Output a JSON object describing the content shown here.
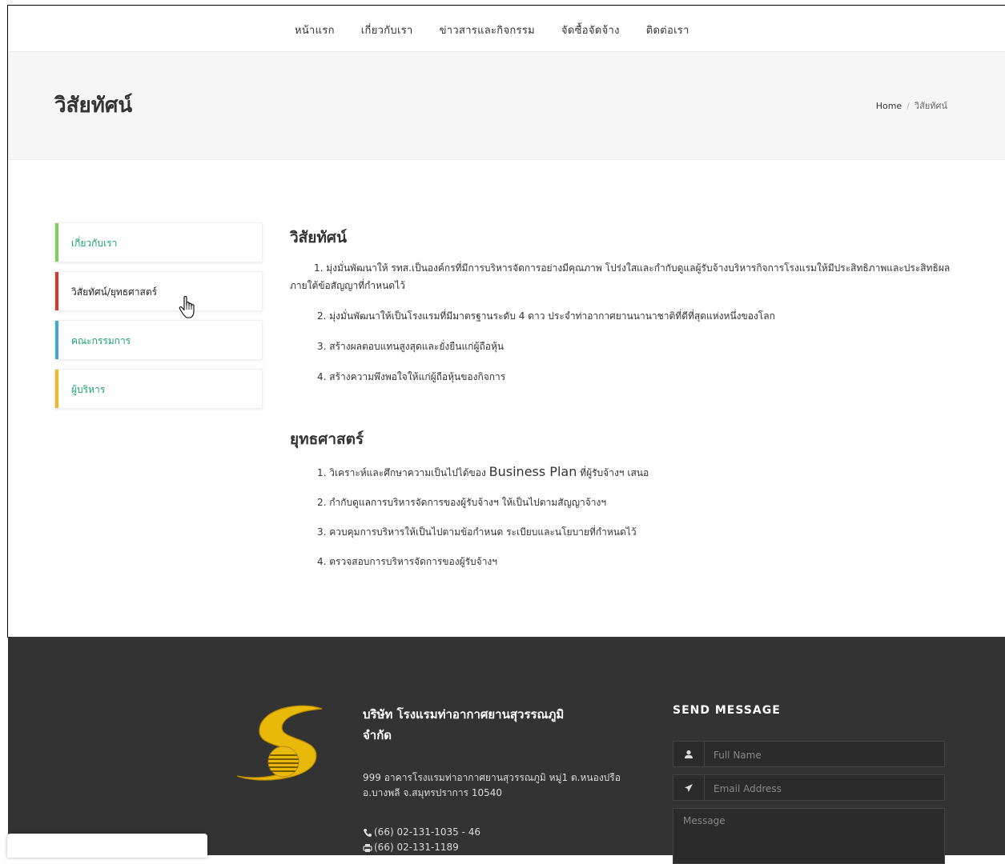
{
  "nav": {
    "items": [
      "หน้าแรก",
      "เกี่ยวกับเรา",
      "ข่าวสารและกิจกรรม",
      "จัดซื้อจัดจ้าง",
      "ติดต่อเรา"
    ]
  },
  "page": {
    "title": "วิสัยทัศน์",
    "breadcrumb": {
      "home": "Home",
      "separator": "/",
      "current": "วิสัยทัศน์"
    }
  },
  "sidebar": {
    "items": [
      {
        "label": "เกี่ยวกับเรา",
        "color": "#7fd05a",
        "active": false
      },
      {
        "label": "วิสัยทัศน์/ยุทธศาสตร์",
        "color": "#d9392b",
        "active": true
      },
      {
        "label": "คณะกรรมการ",
        "color": "#3fa9d6",
        "active": false
      },
      {
        "label": "ผู้บริหาร",
        "color": "#f5b529",
        "active": false
      }
    ]
  },
  "content": {
    "vision_title": "วิสัยทัศน์",
    "vision": [
      "1. มุ่งมั่นพัฒนาให้ รทส.เป็นองค์กรที่มีการบริหารจัดการอย่างมีคุณภาพ โปร่งใสและกำกับดูแลผู้รับจ้างบริหารกิจการโรงแรมให้มีประสิทธิภาพและประสิทธิผลภายใต้ข้อสัญญาที่กำหนดไว้",
      "2. มุ่งมั่นพัฒนาให้เป็นโรงแรมที่มีมาตรฐานระดับ 4 ดาว ประจำท่าอากาศยานนานาชาติที่ดีที่สุดแห่งหนึ่งของโลก",
      "3. สร้างผลตอบแทนสูงสุดและยั่งยืนแก่ผู้ถือหุ้น",
      "4. สร้างความพึงพอใจให้แก่ผู้ถือหุ้นของกิจการ"
    ],
    "strategy_title": "ยุทธศาสตร์",
    "strategy": {
      "item1_prefix": "1. วิเคราะห์และศึกษาความเป็นไปได้ของ",
      "item1_bp": "Business Plan",
      "item1_suffix": "ที่ผู้รับจ้างฯ เสนอ",
      "items": [
        "2. กำกับดูแลการบริหารจัดการของผู้รับจ้างฯ ให้เป็นไปตามสัญญาจ้างฯ",
        "3. ควบคุมการบริหารให้เป็นไปตามข้อกำหนด ระเบียบและนโยบายที่กำหนดไว้",
        "4. ตรวจสอบการบริหารจัดการของผู้รับจ้างฯ"
      ]
    }
  },
  "footer": {
    "company_line1": "บริษัท โรงแรมท่าอากาศยานสุวรรณภูมิ",
    "company_line2": "จำกัด",
    "address_line1": "999 อาคารโรงแรมท่าอากาศยานสุวรรณภูมิ หมู่1 ต.หนองปรือ",
    "address_line2": "อ.บางพลี จ.สมุทรปราการ 10540",
    "phone": "(66) 02-131-1035 - 46",
    "fax": "(66) 02-131-1189",
    "send_title": "SEND MESSAGE",
    "fullname_placeholder": "Full Name",
    "email_placeholder": "Email Address",
    "message_placeholder": "Message"
  },
  "icons": {
    "user": "user-icon",
    "send": "paper-plane-icon",
    "phone": "phone-icon",
    "fax": "print-icon",
    "cursor": "hand-pointer-icon"
  },
  "colors": {
    "link": "#1aa36f",
    "footer_bg": "#333333",
    "logo_gold": "#e9b90a"
  }
}
